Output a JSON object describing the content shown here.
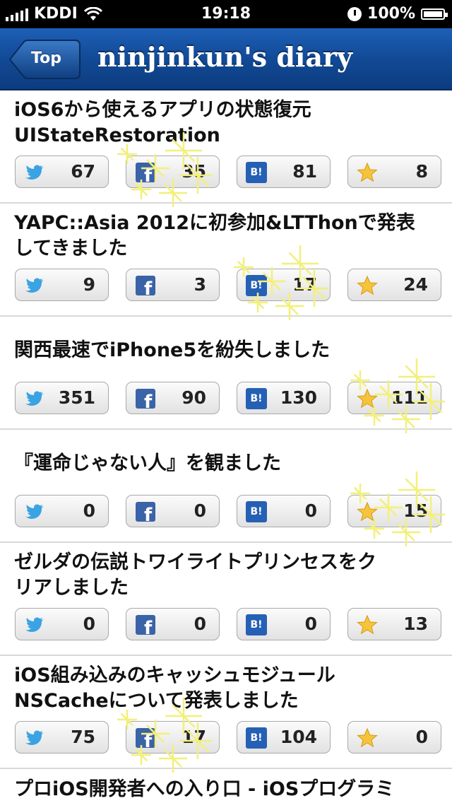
{
  "status": {
    "carrier": "KDDI",
    "time": "19:18",
    "battery": "100%"
  },
  "navbar": {
    "back_label": "Top",
    "title": "ninjinkun's diary"
  },
  "entries": [
    {
      "title": "iOS6から使えるアプリの状態復元\nUIStateRestoration",
      "twitter": "67",
      "facebook": "35",
      "hatena": "81",
      "star": "8"
    },
    {
      "title": "YAPC::Asia 2012に初参加&LTThonで発表\nしてきました",
      "twitter": "9",
      "facebook": "3",
      "hatena": "17",
      "star": "24"
    },
    {
      "title": "関西最速でiPhone5を紛失しました",
      "twitter": "351",
      "facebook": "90",
      "hatena": "130",
      "star": "111"
    },
    {
      "title": "『運命じゃない人』を観ました",
      "twitter": "0",
      "facebook": "0",
      "hatena": "0",
      "star": "15"
    },
    {
      "title": "ゼルダの伝説トワイライトプリンセスをク\nリアしました",
      "twitter": "0",
      "facebook": "0",
      "hatena": "0",
      "star": "13"
    },
    {
      "title": "iOS組み込みのキャッシュモジュール\nNSCacheについて発表しました",
      "twitter": "75",
      "facebook": "17",
      "hatena": "104",
      "star": "0"
    }
  ],
  "last_entry": {
    "title": "プロiOS開発者への入り口 - iOSプログラミ"
  },
  "icons": {
    "twitter": "twitter-bird-icon",
    "facebook": "facebook-icon",
    "hatena": "hatena-bookmark-icon",
    "star": "star-icon"
  },
  "hatena_glyph": "B!",
  "facebook_glyph": "f",
  "colors": {
    "navbar": "#124a96",
    "twitter": "#3aa3e3",
    "facebook": "#3a63a8",
    "hatena": "#2560b4",
    "star": "#f5c43a",
    "sparkle": "#f2f07a"
  }
}
